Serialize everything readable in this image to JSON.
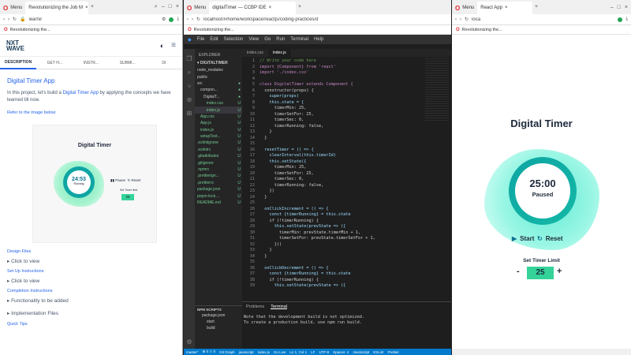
{
  "left_browser": {
    "tab1": "Revolutionizing the Job M",
    "tab1_menu": "Menu",
    "url": "learnir",
    "bookmark": "Revolutionizing the...",
    "logo_line1": "NXT",
    "logo_line2": "WAVE",
    "tabs": [
      "DESCRIPTION",
      "GET H...",
      "INSTR...",
      "SUBMI...",
      "DI"
    ],
    "title": "Digital Timer App",
    "para_a": "In this project, let's build a ",
    "para_link": "Digital Timer App",
    "para_b": " by applying the concepts we have learned till now.",
    "refer": "Refer to the image below:",
    "ref_title": "Digital Timer",
    "ref_time": "24:53",
    "ref_status": "Running",
    "ref_pause": "Pause",
    "ref_reset": "Reset",
    "ref_limit": "Set Timer limit",
    "ref_value": "25",
    "sections": [
      {
        "header": "Design Files",
        "item": "Click to view"
      },
      {
        "header": "Set Up Instructions",
        "item": "Click to view"
      },
      {
        "header": "Completion Instructions",
        "item": "Functionality to be added"
      },
      {
        "header": "",
        "item": "Implementation Files"
      },
      {
        "header": "Quick Tips",
        "item": ""
      }
    ]
  },
  "ide": {
    "tab_menu": "Menu",
    "tab": "digitalTimer — CCBP IDE",
    "url": "localhost/#/home/workspace/reactjs/coding-practices/d",
    "bookmark": "Revolutionizing the...",
    "menus": [
      "File",
      "Edit",
      "Selection",
      "View",
      "Go",
      "Run",
      "Terminal",
      "Help"
    ],
    "explorer": "EXPLORER",
    "root": "DIGITALTIMER",
    "files": [
      {
        "n": "node_modules",
        "i": 0,
        "s": ""
      },
      {
        "n": "public",
        "i": 0,
        "s": ""
      },
      {
        "n": "src",
        "i": 0,
        "s": "●"
      },
      {
        "n": "compon...",
        "i": 1,
        "s": "●"
      },
      {
        "n": "DigitalT...",
        "i": 2,
        "s": "●"
      },
      {
        "n": "index.css",
        "i": 3,
        "s": "U"
      },
      {
        "n": "index.js",
        "i": 3,
        "s": "U"
      },
      {
        "n": "App.css",
        "i": 1,
        "s": "U"
      },
      {
        "n": "App.js",
        "i": 1,
        "s": "U"
      },
      {
        "n": "index.js",
        "i": 1,
        "s": "U"
      },
      {
        "n": "setupTest...",
        "i": 1,
        "s": "U"
      },
      {
        "n": ".eslintignore",
        "i": 0,
        "s": "U"
      },
      {
        "n": ".eslintrc",
        "i": 0,
        "s": "U"
      },
      {
        "n": ".gitattributes",
        "i": 0,
        "s": "U"
      },
      {
        "n": ".gitignore",
        "i": 0,
        "s": "U"
      },
      {
        "n": ".npmrc",
        "i": 0,
        "s": "U"
      },
      {
        "n": ".prettierign...",
        "i": 0,
        "s": "U"
      },
      {
        "n": ".prettierrc",
        "i": 0,
        "s": "U"
      },
      {
        "n": "package.json",
        "i": 0,
        "s": "U"
      },
      {
        "n": "pnpm-lock....",
        "i": 0,
        "s": "U"
      },
      {
        "n": "README.md",
        "i": 0,
        "s": "U"
      }
    ],
    "editor_tabs": [
      "index.css",
      "index.js"
    ],
    "code": [
      "// Write your code here",
      "import {Component} from 'react'",
      "import './index.css'",
      "",
      "class DigitalTimer extends Component {",
      "  constructor(props) {",
      "    super(props)",
      "    this.state = {",
      "      timerMin: 25,",
      "      timerSetFor: 25,",
      "      timerSec: 0,",
      "      timerRunning: false,",
      "    }",
      "  }",
      "",
      "  resetTimer = () => {",
      "    clearInterval(this.timerId)",
      "    this.setState({",
      "      timerMin: 25,",
      "      timerSetFor: 25,",
      "      timerSec: 0,",
      "      timerRunning: false,",
      "    })",
      "  }",
      "",
      "  onClickIncrement = () => {",
      "    const {timerRunning} = this.state",
      "    if (!timerRunning) {",
      "      this.setState(prevState => ({",
      "        timerMin: prevState.timerMin + 1,",
      "        timerSetFor: prevState.timerSetFor + 1,",
      "      }))",
      "    }",
      "  }",
      "",
      "  onClickDecrement = () => {",
      "    const {timerRunning} = this.state",
      "    if (!timerRunning) {",
      "      this.setState(prevState => ({"
    ],
    "panel_tabs": [
      "Problems",
      "Terminal"
    ],
    "terminal": [
      "Note that the development build is not optimized.",
      "To create a production build, use npm run build."
    ],
    "npm": "NPM SCRIPTS",
    "npm_items": [
      "package.json",
      "start",
      "build"
    ],
    "status": [
      "master*",
      "⊗ 0 ⚠ 0",
      "Git Graph",
      "javascript",
      "index.js",
      "Go Live",
      "Ln 1, Col 1",
      "LF",
      "UTF-8",
      "Spaces: 4",
      "JavaScript",
      "ESLint",
      "Prettier"
    ]
  },
  "app": {
    "tab_menu": "Menu",
    "tab": "React App",
    "url": "loca",
    "bookmark": "Revolutionizing the...",
    "title": "Digital Timer",
    "time": "25:00",
    "status": "Paused",
    "start": "Start",
    "reset": "Reset",
    "limit_label": "Set Timer Limit",
    "minus": "-",
    "value": "25",
    "plus": "+"
  }
}
